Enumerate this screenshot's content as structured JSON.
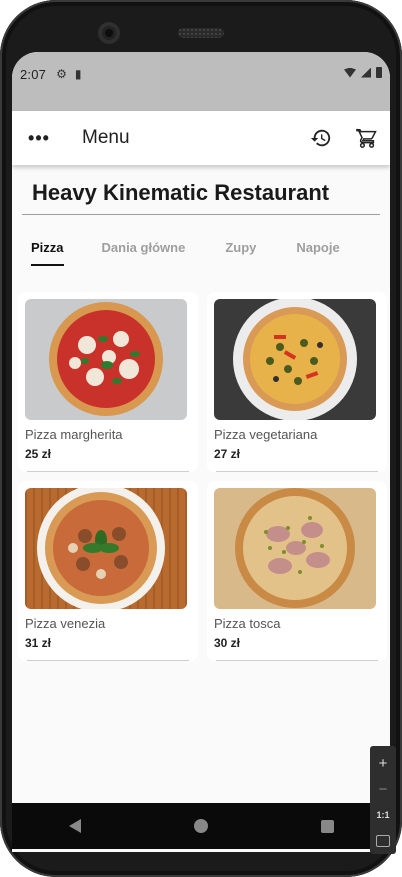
{
  "status_bar": {
    "time": "2:07",
    "icons": [
      "settings-icon",
      "sd-card-icon",
      "wifi-icon",
      "cell-signal-icon",
      "battery-icon"
    ]
  },
  "app_bar": {
    "title": "Menu",
    "actions": [
      "more-options-icon",
      "history-icon",
      "cart-icon"
    ]
  },
  "restaurant": {
    "name": "Heavy Kinematic Restaurant"
  },
  "tabs": [
    {
      "label": "Pizza",
      "active": true
    },
    {
      "label": "Dania główne",
      "active": false
    },
    {
      "label": "Zupy",
      "active": false
    },
    {
      "label": "Napoje",
      "active": false
    }
  ],
  "products": [
    {
      "name": "Pizza margherita",
      "price": "25 zł"
    },
    {
      "name": "Pizza vegetariana",
      "price": "27 zł"
    },
    {
      "name": "Pizza venezia",
      "price": "31 zł"
    },
    {
      "name": "Pizza tosca",
      "price": "30 zł"
    }
  ],
  "zoom_controls": {
    "zoom_in": "+",
    "zoom_out": "−",
    "ratio": "1:1"
  },
  "colors": {
    "status_bar": "#bdbdbd",
    "screen_background": "#fafafa",
    "active_tab": "#111111",
    "inactive_tab": "#9e9e9e"
  }
}
